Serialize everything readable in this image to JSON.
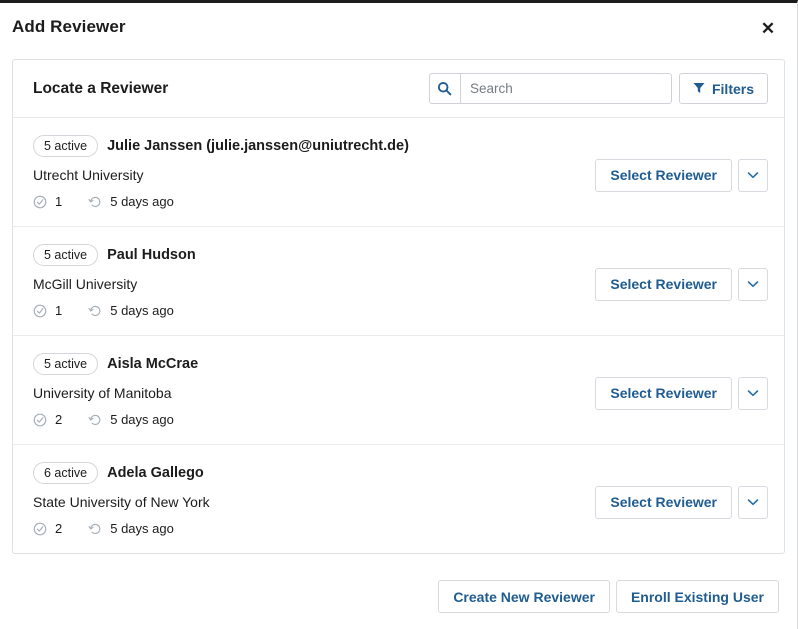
{
  "modal": {
    "title": "Add Reviewer",
    "close_label": "✕"
  },
  "card": {
    "heading": "Locate a Reviewer",
    "search": {
      "placeholder": "Search",
      "value": "",
      "icon": "search-icon"
    },
    "filters": {
      "label": "Filters",
      "icon": "funnel-icon"
    }
  },
  "reviewers": [
    {
      "badge": "5 active",
      "name": "Julie Janssen (julie.janssen@uniutrecht.de)",
      "affiliation": "Utrecht University",
      "completed_count": "1",
      "completed_icon": "check-circle-icon",
      "last_activity": "5 days ago",
      "activity_icon": "history-icon",
      "select_label": "Select Reviewer",
      "caret_icon": "chevron-down-icon"
    },
    {
      "badge": "5 active",
      "name": "Paul Hudson",
      "affiliation": "McGill University",
      "completed_count": "1",
      "completed_icon": "check-circle-icon",
      "last_activity": "5 days ago",
      "activity_icon": "history-icon",
      "select_label": "Select Reviewer",
      "caret_icon": "chevron-down-icon"
    },
    {
      "badge": "5 active",
      "name": "Aisla McCrae",
      "affiliation": "University of Manitoba",
      "completed_count": "2",
      "completed_icon": "check-circle-icon",
      "last_activity": "5 days ago",
      "activity_icon": "history-icon",
      "select_label": "Select Reviewer",
      "caret_icon": "chevron-down-icon"
    },
    {
      "badge": "6 active",
      "name": "Adela Gallego",
      "affiliation": "State University of New York",
      "completed_count": "2",
      "completed_icon": "check-circle-icon",
      "last_activity": "5 days ago",
      "activity_icon": "history-icon",
      "select_label": "Select Reviewer",
      "caret_icon": "chevron-down-icon"
    }
  ],
  "footer": {
    "create_new_reviewer": "Create New Reviewer",
    "enroll_existing_user": "Enroll Existing User"
  },
  "colors": {
    "link_blue": "#1f5c91",
    "text": "#1c1c1c",
    "border": "#d6d9dd",
    "icon_gray": "#9aa2ab"
  }
}
